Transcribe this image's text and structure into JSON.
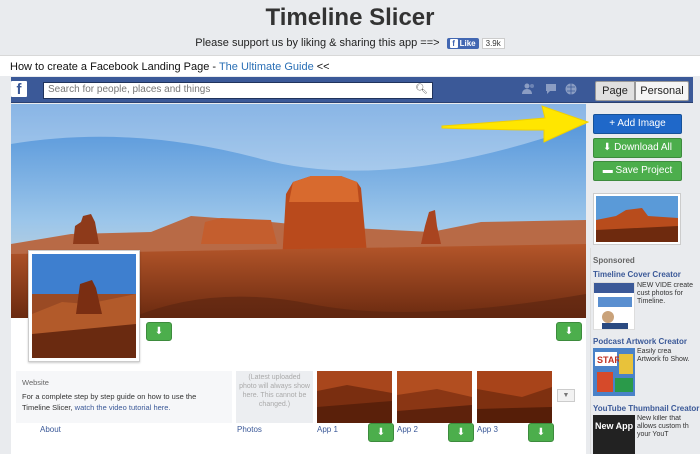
{
  "header": {
    "title": "Timeline Slicer",
    "support_text": "Please support us by liking & sharing this app ==>",
    "like_label": "Like",
    "like_count": "3.9k"
  },
  "howto": {
    "prefix": "How to create a Facebook Landing Page - ",
    "link_text": "The Ultimate Guide",
    "suffix": " <<"
  },
  "fb": {
    "logo": "f",
    "search_placeholder": "Search for people, places and things",
    "icons": [
      "friends-icon",
      "messages-icon",
      "globe-icon"
    ],
    "tabs": {
      "page": "Page",
      "personal": "Personal"
    }
  },
  "page": {
    "info": {
      "heading": "Website",
      "text_before": "For a complete step by step guide on how to use the Timeline Slicer, ",
      "link": "watch the video tutorial here."
    },
    "photos_placeholder": "(Latest uploaded photo will always show here. This cannot be changed.)",
    "nav": {
      "about": "About",
      "photos": "Photos",
      "app1": "App 1",
      "app2": "App 2",
      "app3": "App 3"
    },
    "dropdown": "▼"
  },
  "sidebar": {
    "add_image": "Add Image",
    "download_all": "Download All",
    "save_project": "Save Project",
    "sponsored": "Sponsored",
    "ads": [
      {
        "title": "Timeline Cover Creator",
        "text": "NEW VIDE create cust photos for Timeline."
      },
      {
        "title": "Podcast Artwork Creator",
        "text": "Easily crea Artwork fo Show."
      },
      {
        "title": "YouTube Thumbnail Creator",
        "text": "New killer that allows custom th your YouT"
      }
    ],
    "ad_image_texts": {
      "ad2": "START",
      "ad3": "New App For YouTube!"
    }
  },
  "colors": {
    "fb_blue": "#3b5998",
    "primary": "#1f68c9",
    "success": "#4cae4c",
    "arrow": "#ffe600"
  }
}
